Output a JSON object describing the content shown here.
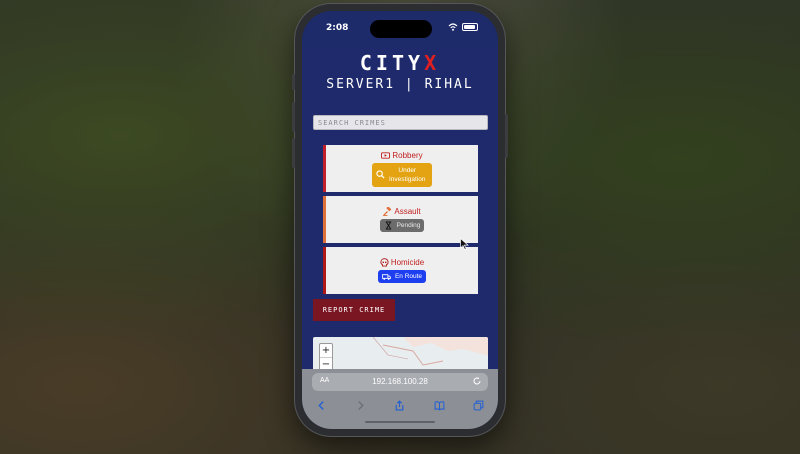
{
  "status_bar": {
    "time": "2:08"
  },
  "app": {
    "brand_main": "CITY",
    "brand_accent": "X",
    "subtitle": "SERVER1 | RIHAL",
    "search": {
      "placeholder": "SEARCH CRIMES",
      "value": ""
    },
    "crimes": [
      {
        "title": "Robbery",
        "icon": "video-icon",
        "status": "Under Investigation",
        "status_line1": "Under",
        "status_line2": "Investigation",
        "status_icon": "magnifier-icon",
        "status_color": "#e3a312"
      },
      {
        "title": "Assault",
        "icon": "gavel-icon",
        "status": "Pending",
        "status_icon": "hourglass-icon",
        "status_color": "#6c6c6c"
      },
      {
        "title": "Homicide",
        "icon": "skull-icon",
        "status": "En Route",
        "status_icon": "van-icon",
        "status_color": "#1e3ff0"
      }
    ],
    "report_button": "REPORT CRIME",
    "map": {
      "zoom_in": "+",
      "zoom_out": "−"
    }
  },
  "browser": {
    "aa": "AA",
    "url": "192.168.100.28"
  },
  "colors": {
    "app_background": "#1e2a6b",
    "accent_red": "#e02020",
    "report_button": "#7a1522"
  }
}
